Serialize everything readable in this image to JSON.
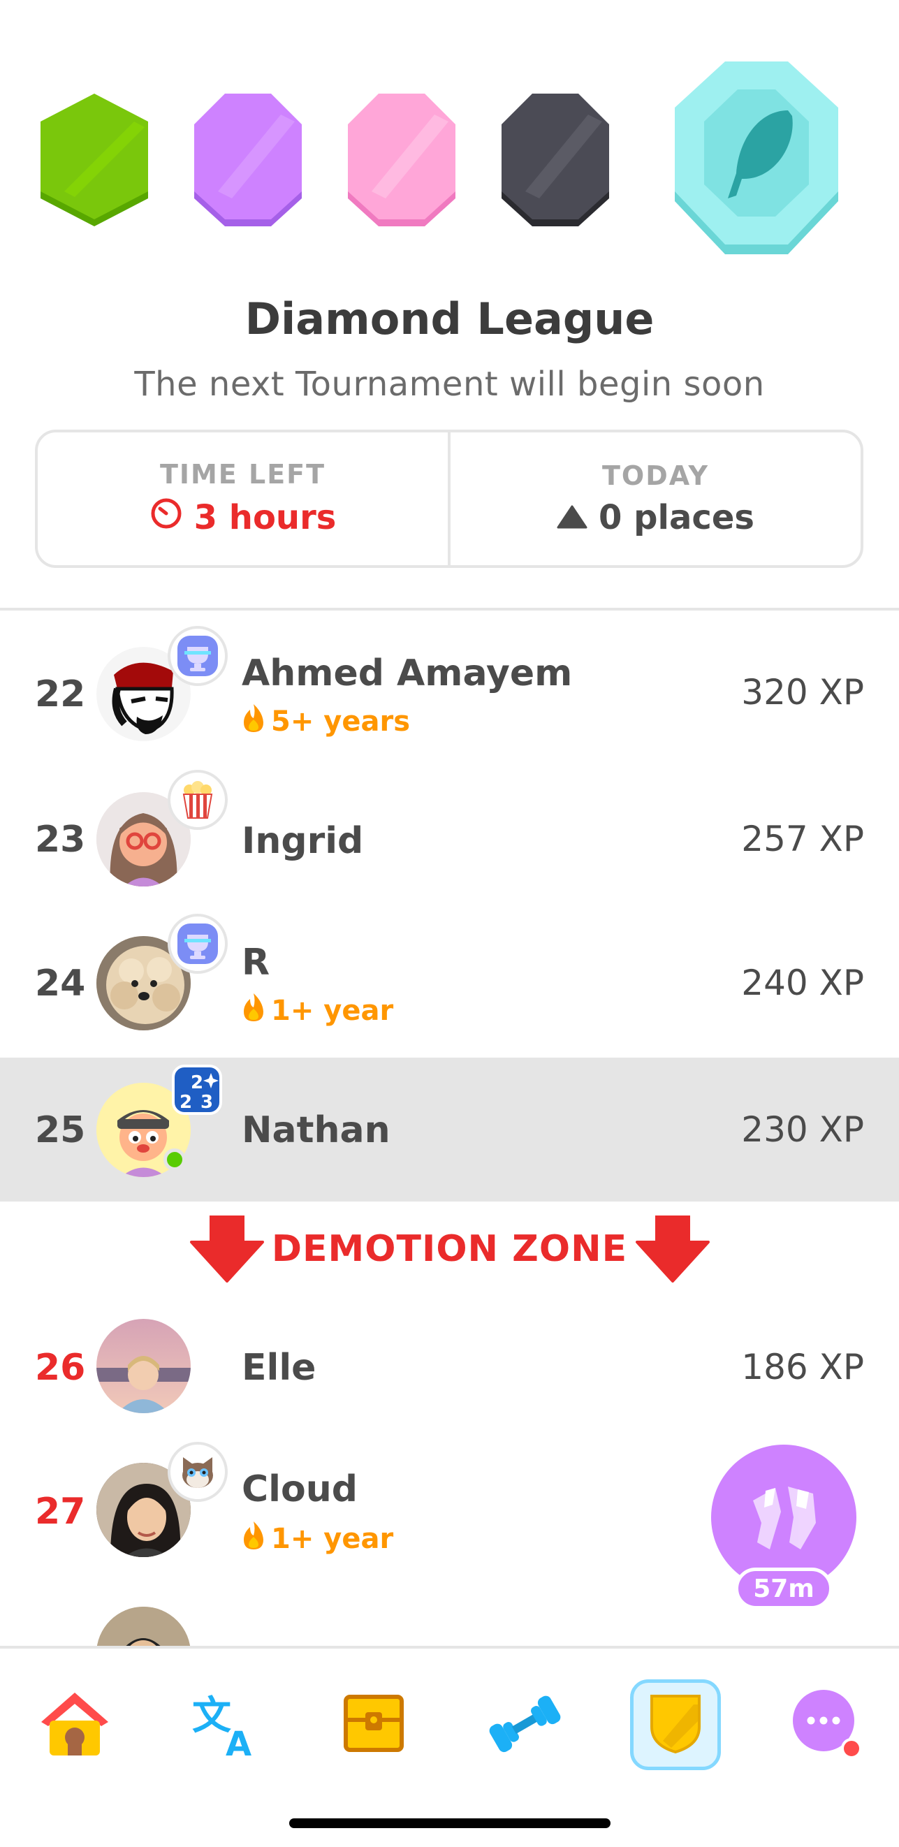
{
  "league": {
    "title": "Diamond League",
    "subtitle": "The next Tournament will begin soon",
    "badges": [
      {
        "name": "emerald",
        "color": "#7ac70c"
      },
      {
        "name": "amethyst",
        "color": "#ce82ff"
      },
      {
        "name": "pearl",
        "color": "#ffa6d8"
      },
      {
        "name": "obsidian",
        "color": "#4b4b55"
      },
      {
        "name": "diamond",
        "color": "#9ef0f0",
        "current": true
      }
    ]
  },
  "info": {
    "time_left_label": "TIME LEFT",
    "time_left_value": "3 hours",
    "today_label": "TODAY",
    "today_value": "0 places"
  },
  "leaderboard": [
    {
      "rank": "22",
      "name": "Ahmed Amayem",
      "streak": "5+ years",
      "xp": "320 XP",
      "badge": "trophy-icon"
    },
    {
      "rank": "23",
      "name": "Ingrid",
      "streak": "",
      "xp": "257 XP",
      "badge": "popcorn-icon"
    },
    {
      "rank": "24",
      "name": "R",
      "streak": "1+ year",
      "xp": "240 XP",
      "badge": "trophy-icon"
    },
    {
      "rank": "25",
      "name": "Nathan",
      "streak": "",
      "xp": "230 XP",
      "badge": "year-2023-icon",
      "current_user": true
    },
    {
      "rank": "26",
      "name": "Elle",
      "streak": "",
      "xp": "186 XP"
    },
    {
      "rank": "27",
      "name": "Cloud",
      "streak": "1+ year",
      "xp": "",
      "badge": "cat-icon"
    }
  ],
  "demotion_label": "DEMOTION ZONE",
  "timer_bubble": {
    "time": "57m"
  },
  "nav": [
    {
      "name": "home-icon"
    },
    {
      "name": "translate-icon"
    },
    {
      "name": "treasure-chest-icon"
    },
    {
      "name": "dumbbell-icon"
    },
    {
      "name": "leaderboard-shield-icon",
      "active": true
    },
    {
      "name": "more-icon"
    }
  ],
  "colors": {
    "accent_red": "#ea2b2b",
    "streak_orange": "#ff9600",
    "blue_active": "#84d8ff",
    "purple": "#ce82ff"
  }
}
